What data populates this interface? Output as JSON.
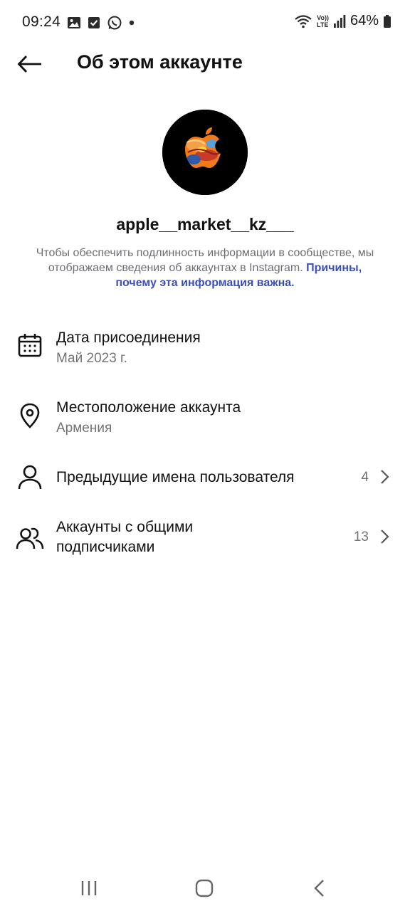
{
  "status_bar": {
    "time": "09:24",
    "battery": "64%",
    "left_icons": [
      "image-icon",
      "check-box-icon",
      "whatsapp-icon",
      "dot-icon"
    ],
    "right_icons": [
      "wifi-icon",
      "volte-icon",
      "signal-icon",
      "battery-icon"
    ],
    "volte_top": "Vo))",
    "volte_bottom": "LTE"
  },
  "header": {
    "title": "Об этом аккаунте",
    "back_icon": "arrow-left-icon"
  },
  "profile": {
    "username": "apple__market__kz___",
    "info_text": "Чтобы обеспечить подлинность информации в сообществе, мы отображаем сведения об аккаунтах в Instagram. ",
    "info_link": "Причины, почему эта информация важна."
  },
  "rows": [
    {
      "icon": "calendar-icon",
      "title": "Дата присоединения",
      "subtitle": "Май 2023 г."
    },
    {
      "icon": "location-pin-icon",
      "title": "Местоположение аккаунта",
      "subtitle": "Армения"
    },
    {
      "icon": "person-icon",
      "title": "Предыдущие имена пользователя",
      "count": "4"
    },
    {
      "icon": "people-icon",
      "title_line1": "Аккаунты с общими",
      "title_line2": "подписчиками",
      "count": "13"
    }
  ],
  "nav": {
    "recents_icon": "recent-apps-icon",
    "home_icon": "home-icon",
    "back_icon": "back-chevron-icon"
  },
  "colors": {
    "link": "#3b4fb8",
    "secondary_text": "#737373",
    "avatar_bg": "#000000"
  }
}
